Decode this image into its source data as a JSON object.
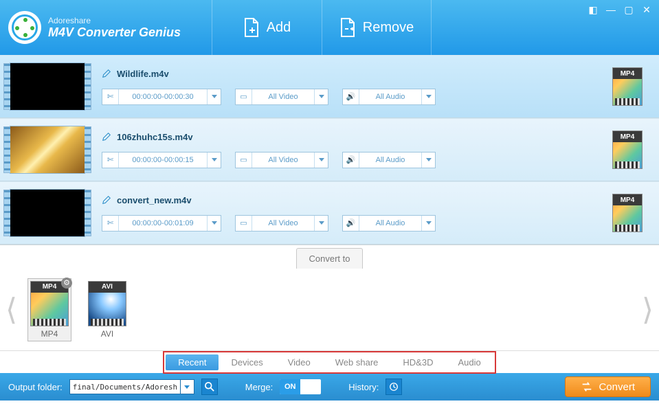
{
  "brand": {
    "company": "Adoreshare",
    "product": "M4V Converter Genius"
  },
  "header_buttons": {
    "add": "Add",
    "remove": "Remove"
  },
  "files": [
    {
      "name": "Wildlife.m4v",
      "time": "00:00:00-00:00:30",
      "video": "All Video",
      "audio": "All Audio",
      "fmt": "MP4",
      "thumb": "black"
    },
    {
      "name": "106zhuhc15s.m4v",
      "time": "00:00:00-00:00:15",
      "video": "All Video",
      "audio": "All Audio",
      "fmt": "MP4",
      "thumb": "gold"
    },
    {
      "name": "convert_new.m4v",
      "time": "00:00:00-00:01:09",
      "video": "All Video",
      "audio": "All Audio",
      "fmt": "MP4",
      "thumb": "black"
    }
  ],
  "convert_to_label": "Convert to",
  "formats": [
    {
      "label": "MP4",
      "badge": "MP4"
    },
    {
      "label": "AVI",
      "badge": "AVI"
    }
  ],
  "tabs": [
    "Recent",
    "Devices",
    "Video",
    "Web share",
    "HD&3D",
    "Audio"
  ],
  "footer": {
    "output_label": "Output folder:",
    "output_value": "final/Documents/Adoreshare",
    "merge_label": "Merge:",
    "merge_state": "ON",
    "history_label": "History:",
    "convert_label": "Convert"
  }
}
